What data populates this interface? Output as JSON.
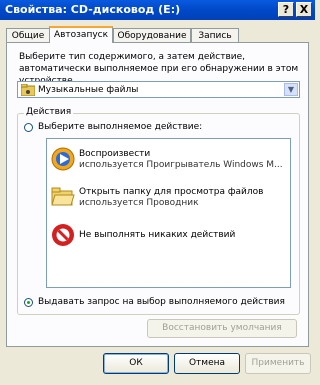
{
  "window": {
    "title": "Свойства: CD-дисковод (E:)",
    "help_label": "?",
    "close_label": "X"
  },
  "tabs": [
    {
      "label": "Общие"
    },
    {
      "label": "Автозапуск"
    },
    {
      "label": "Оборудование"
    },
    {
      "label": "Запись"
    }
  ],
  "autoplay": {
    "description": "Выберите тип содержимого, а затем действие, автоматически выполняемое при его обнаружении в этом устройстве",
    "content_type": "Музыкальные файлы",
    "group_label": "Действия",
    "choose_action_label": "Выберите выполняемое действие:",
    "actions": [
      {
        "line1": "Воспроизвести",
        "line2": "используется Проигрыватель Windows M...",
        "icon": "media-player-icon"
      },
      {
        "line1": "Открыть папку для просмотра файлов",
        "line2": "используется Проводник",
        "icon": "open-folder-icon"
      },
      {
        "line1": "Не выполнять никаких действий",
        "line2": "",
        "icon": "no-action-icon"
      }
    ],
    "prompt_label": "Выдавать запрос на выбор выполняемого действия",
    "prompt_selected": true,
    "restore_label": "Восстановить умолчания"
  },
  "buttons": {
    "ok": "ОК",
    "cancel": "Отмена",
    "apply": "Применить"
  }
}
